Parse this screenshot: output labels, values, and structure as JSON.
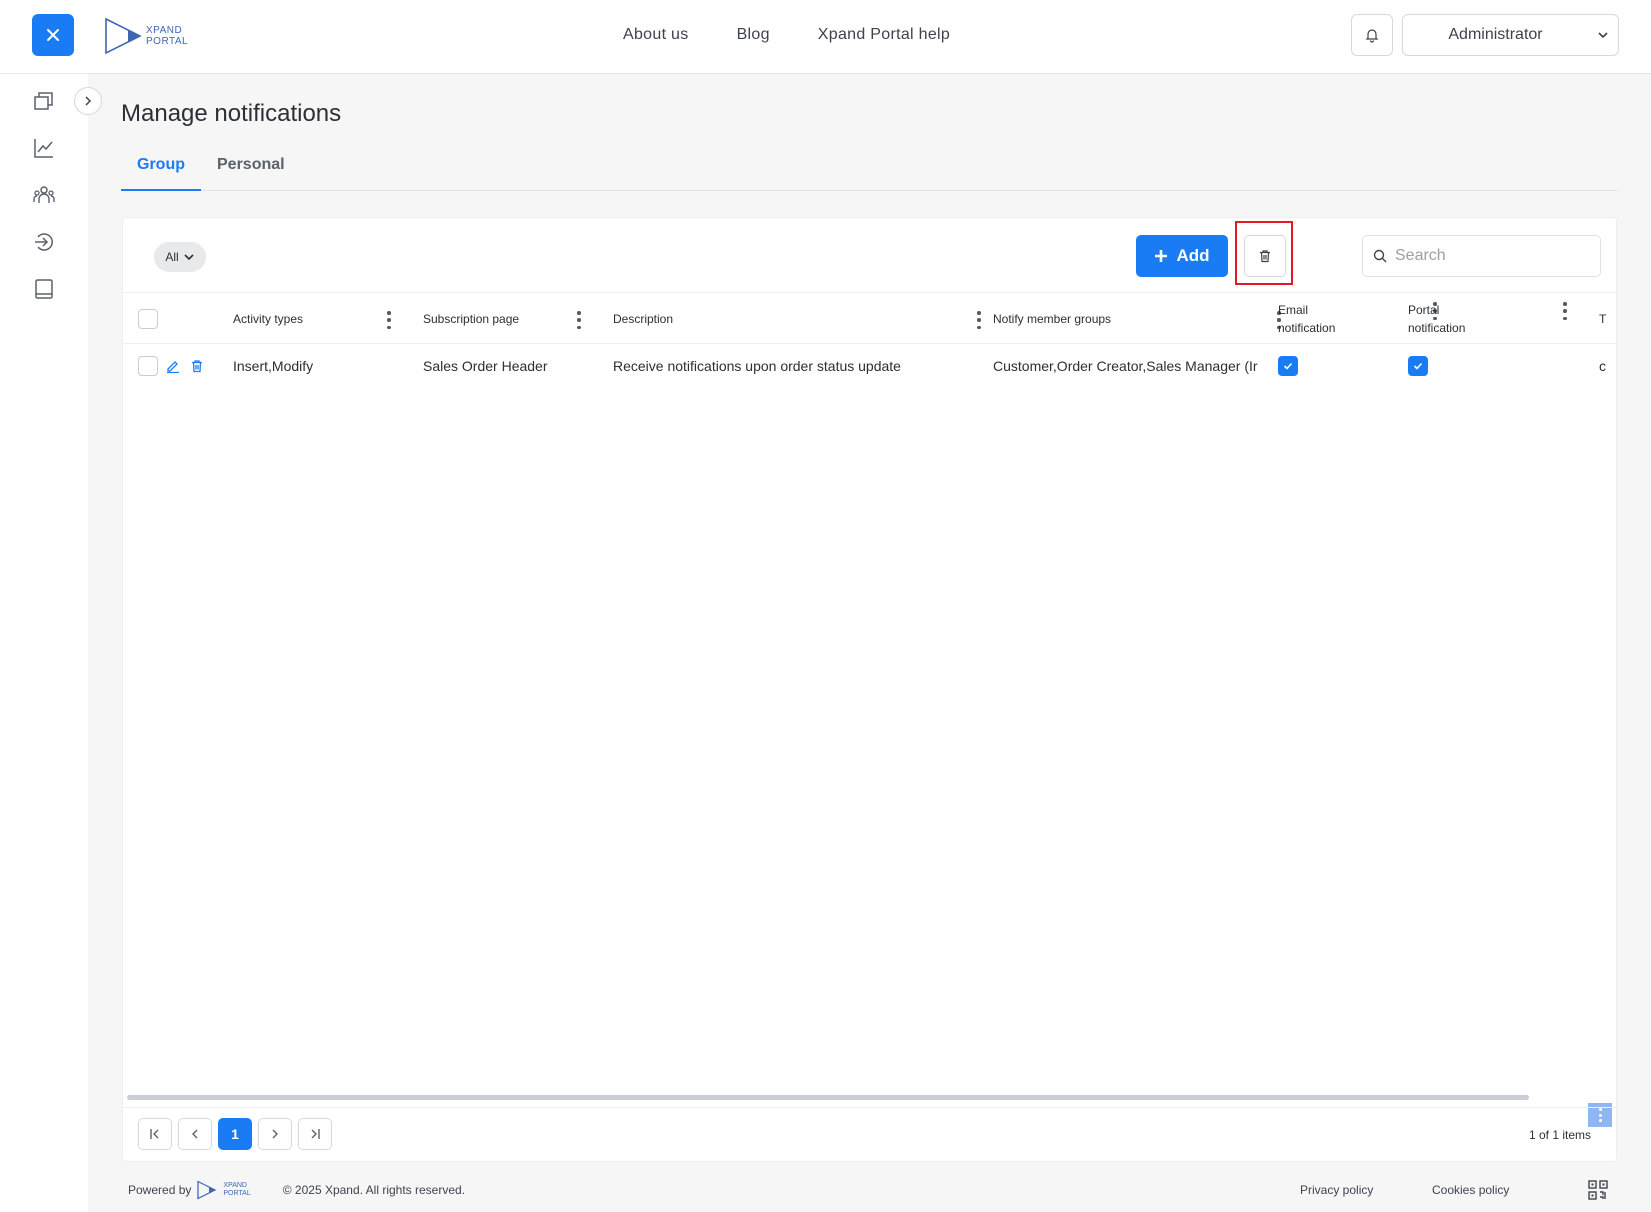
{
  "header": {
    "logo_text_line1": "XPAND",
    "logo_text_line2": "PORTAL",
    "nav": [
      "About us",
      "Blog",
      "Xpand Portal help"
    ],
    "user": "Administrator"
  },
  "sidebar": {
    "icons": [
      "documents-icon",
      "chart-icon",
      "users-group-icon",
      "sign-in-icon",
      "book-icon"
    ]
  },
  "page": {
    "title": "Manage notifications",
    "tabs": [
      {
        "label": "Group",
        "active": true
      },
      {
        "label": "Personal",
        "active": false
      }
    ]
  },
  "toolbar": {
    "filter_label": "All",
    "add_label": "Add",
    "search_placeholder": "Search"
  },
  "table": {
    "columns": {
      "activity_types": "Activity types",
      "subscription_page": "Subscription page",
      "description": "Description",
      "notify_member_groups": "Notify member groups",
      "email_line1": "Email",
      "email_line2": "notification",
      "portal_line1": "Portal",
      "portal_line2": "notification",
      "next_partial": "T"
    },
    "rows": [
      {
        "activity_types": "Insert,Modify",
        "subscription_page": "Sales Order Header",
        "description": "Receive notifications upon order status update",
        "notify_member_groups": "Customer,Order Creator,Sales Manager (Ir",
        "email_notification": true,
        "portal_notification": true,
        "next_partial": "c"
      }
    ]
  },
  "pagination": {
    "current_page": "1",
    "items_label": "1 of 1 items"
  },
  "footer": {
    "powered_by": "Powered by",
    "copyright": "© 2025 Xpand. All rights reserved.",
    "privacy": "Privacy policy",
    "cookies": "Cookies policy"
  },
  "colors": {
    "accent": "#1a7cf5",
    "highlight": "#e01b24"
  }
}
